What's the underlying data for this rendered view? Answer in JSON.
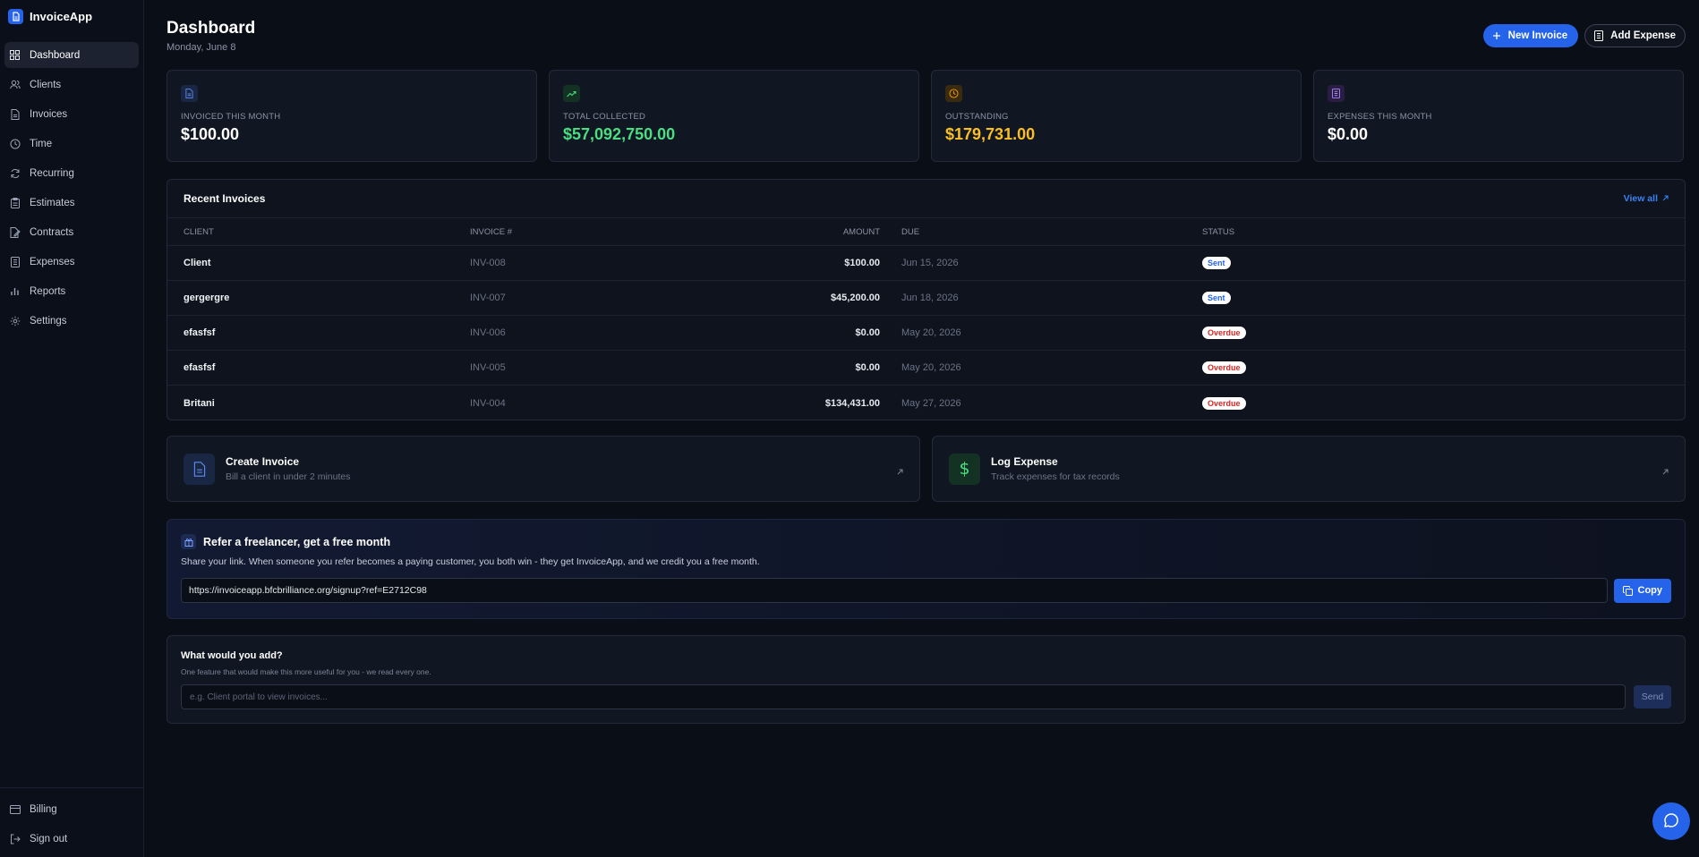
{
  "app": {
    "name": "InvoiceApp",
    "logo_icon": "document-icon"
  },
  "sidebar": {
    "items": [
      {
        "label": "Dashboard",
        "icon": "grid-icon",
        "active": true
      },
      {
        "label": "Clients",
        "icon": "users-icon"
      },
      {
        "label": "Invoices",
        "icon": "document-icon"
      },
      {
        "label": "Time",
        "icon": "clock-icon"
      },
      {
        "label": "Recurring",
        "icon": "refresh-icon"
      },
      {
        "label": "Estimates",
        "icon": "clipboard-icon"
      },
      {
        "label": "Contracts",
        "icon": "contract-icon"
      },
      {
        "label": "Expenses",
        "icon": "receipt-icon"
      },
      {
        "label": "Reports",
        "icon": "bar-chart-icon"
      },
      {
        "label": "Settings",
        "icon": "gear-icon"
      }
    ],
    "bottom": [
      {
        "label": "Billing",
        "icon": "credit-card-icon"
      },
      {
        "label": "Sign out",
        "icon": "logout-icon"
      }
    ]
  },
  "header": {
    "title": "Dashboard",
    "date": "Monday, June 8",
    "new_invoice_label": "New Invoice",
    "add_expense_label": "Add Expense"
  },
  "stats": [
    {
      "label": "INVOICED THIS MONTH",
      "value": "$100.00",
      "color": "#ffffff",
      "icon": "document-icon",
      "icon_color": "#5b8def",
      "icon_bg": "#1a2744"
    },
    {
      "label": "TOTAL COLLECTED",
      "value": "$57,092,750.00",
      "color": "#4ade80",
      "icon": "trending-up-icon",
      "icon_color": "#4ade80",
      "icon_bg": "#143224"
    },
    {
      "label": "OUTSTANDING",
      "value": "$179,731.00",
      "color": "#fbbf24",
      "icon": "clock-icon",
      "icon_color": "#f59e0b",
      "icon_bg": "#3a2a10"
    },
    {
      "label": "EXPENSES THIS MONTH",
      "value": "$0.00",
      "color": "#ffffff",
      "icon": "receipt-icon",
      "icon_color": "#a78bfa",
      "icon_bg": "#2a1d44"
    }
  ],
  "recent_invoices": {
    "title": "Recent Invoices",
    "view_all": "View all",
    "columns": {
      "client": "CLIENT",
      "invoice": "INVOICE #",
      "amount": "AMOUNT",
      "due": "DUE",
      "status": "STATUS"
    },
    "rows": [
      {
        "client": "Client",
        "invoice": "INV-008",
        "amount": "$100.00",
        "due": "Jun 15, 2026",
        "status": "Sent",
        "status_type": "sent"
      },
      {
        "client": "gergergre",
        "invoice": "INV-007",
        "amount": "$45,200.00",
        "due": "Jun 18, 2026",
        "status": "Sent",
        "status_type": "sent"
      },
      {
        "client": "efasfsf",
        "invoice": "INV-006",
        "amount": "$0.00",
        "due": "May 20, 2026",
        "status": "Overdue",
        "status_type": "overdue"
      },
      {
        "client": "efasfsf",
        "invoice": "INV-005",
        "amount": "$0.00",
        "due": "May 20, 2026",
        "status": "Overdue",
        "status_type": "overdue"
      },
      {
        "client": "Britani",
        "invoice": "INV-004",
        "amount": "$134,431.00",
        "due": "May 27, 2026",
        "status": "Overdue",
        "status_type": "overdue"
      }
    ]
  },
  "quick_actions": [
    {
      "title": "Create Invoice",
      "subtitle": "Bill a client in under 2 minutes",
      "icon": "document-icon",
      "icon_color": "#5b8def",
      "icon_bg": "#1a2744"
    },
    {
      "title": "Log Expense",
      "subtitle": "Track expenses for tax records",
      "icon": "dollar-icon",
      "icon_color": "#4ade80",
      "icon_bg": "#143224"
    }
  ],
  "referral": {
    "title": "Refer a freelancer, get a free month",
    "description": "Share your link. When someone you refer becomes a paying customer, you both win - they get InvoiceApp, and we credit you a free month.",
    "link": "https://invoiceapp.bfcbrilliance.org/signup?ref=E2712C98",
    "copy_label": "Copy"
  },
  "feedback": {
    "title": "What would you add?",
    "subtitle": "One feature that would make this more useful for you - we read every one.",
    "placeholder": "e.g. Client portal to view invoices...",
    "send_label": "Send"
  }
}
